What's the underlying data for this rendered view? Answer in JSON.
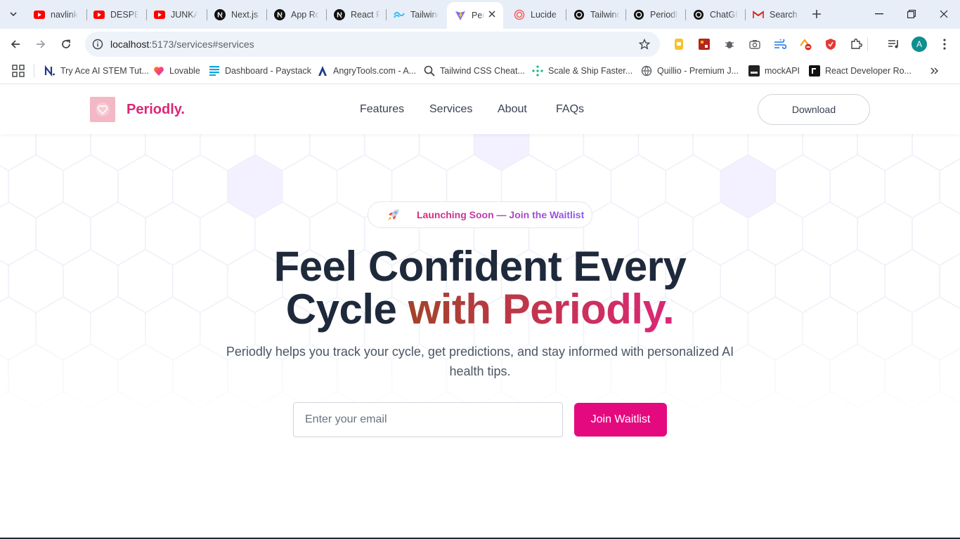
{
  "browser": {
    "tabs": [
      {
        "title": "navlink",
        "icon": "youtube-icon"
      },
      {
        "title": "DESPERADO",
        "icon": "youtube-icon"
      },
      {
        "title": "JUNKAT",
        "icon": "youtube-icon"
      },
      {
        "title": "Next.js",
        "icon": "nextjs-icon"
      },
      {
        "title": "App Router",
        "icon": "nextjs-icon"
      },
      {
        "title": "React F",
        "icon": "nextjs-icon"
      },
      {
        "title": "Tailwind",
        "icon": "tailwind-icon"
      },
      {
        "title": "Periodly",
        "icon": "vite-icon",
        "active": true
      },
      {
        "title": "Lucide",
        "icon": "lucide-icon"
      },
      {
        "title": "Tailwind",
        "icon": "chatgpt-icon"
      },
      {
        "title": "Periodly",
        "icon": "chatgpt-icon"
      },
      {
        "title": "ChatGPT",
        "icon": "chatgpt-icon"
      },
      {
        "title": "Search",
        "icon": "gmail-icon"
      }
    ],
    "url_host": "localhost",
    "url_path": ":5173/services#services",
    "profile_initial": "A",
    "bookmarks": [
      {
        "label": "Try Ace AI STEM Tut...",
        "icon": "n-logo-icon"
      },
      {
        "label": "Lovable",
        "icon": "heart-icon"
      },
      {
        "label": "Dashboard - Paystack",
        "icon": "paystack-icon"
      },
      {
        "label": "AngryTools.com - A...",
        "icon": "angrytools-icon"
      },
      {
        "label": "Tailwind CSS Cheat...",
        "icon": "search-icon"
      },
      {
        "label": "Scale & Ship Faster...",
        "icon": "dots-icon"
      },
      {
        "label": "Quillio - Premium J...",
        "icon": "globe-icon"
      },
      {
        "label": "mockAPI",
        "icon": "mockapi-icon"
      },
      {
        "label": "React Developer Ro...",
        "icon": "roadmap-icon"
      }
    ]
  },
  "site": {
    "brand": "Periodly.",
    "nav": [
      "Features",
      "Services",
      "About",
      "FAQs"
    ],
    "download_label": "Download",
    "badge_text": "Launching Soon — Join the Waitlist",
    "headline_line1": "Feel Confident Every",
    "headline_line2_plain": "Cycle ",
    "headline_line2_accent": "with Periodly.",
    "subtext": "Periodly helps you track your cycle, get predictions, and stay informed with personalized AI health tips.",
    "email_placeholder": "Enter your email",
    "join_label": "Join Waitlist"
  },
  "colors": {
    "brand_pink": "#db2777",
    "button_pink": "#e5097f",
    "heading_dark": "#1e293b"
  }
}
